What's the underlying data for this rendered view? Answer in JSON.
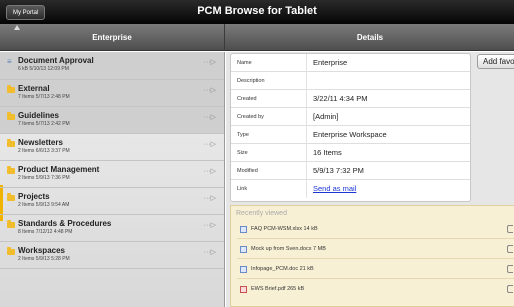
{
  "topbar": {
    "portal_button": "My Portal",
    "title": "PCM Browse for Tablet"
  },
  "headers": {
    "left": "Enterprise",
    "right": "Details"
  },
  "folders": [
    {
      "icon": "document-icon",
      "title": "Document Approval",
      "meta": "6 kB 5/10/13 12:09 PM",
      "selected": true
    },
    {
      "icon": "folder-icon",
      "title": "External",
      "meta": "7 Items 5/7/13 2:48 PM",
      "selected": true
    },
    {
      "icon": "folder-icon",
      "title": "Guidelines",
      "meta": "7 Items 5/7/13 2:42 PM",
      "selected": true
    },
    {
      "icon": "folder-icon",
      "title": "Newsletters",
      "meta": "2 Items 6/6/13 3:37 PM",
      "selected": false
    },
    {
      "icon": "folder-icon",
      "title": "Product Management",
      "meta": "2 Items 5/9/13 7:36 PM",
      "selected": false
    },
    {
      "icon": "folder-icon",
      "title": "Projects",
      "meta": "2 Items 5/9/13 9:54 AM",
      "selected": false
    },
    {
      "icon": "folder-icon",
      "title": "Standards & Procedures",
      "meta": "8 Items 7/12/12 4:48 PM",
      "selected": false
    },
    {
      "icon": "folder-icon",
      "title": "Workspaces",
      "meta": "2 Items 5/9/13 5:28 PM",
      "selected": false
    }
  ],
  "details": [
    {
      "label": "Name",
      "value": "Enterprise"
    },
    {
      "label": "Description",
      "value": ""
    },
    {
      "label": "Created",
      "value": "3/22/11 4:34 PM"
    },
    {
      "label": "Created by",
      "value": "[Admin]"
    },
    {
      "label": "Type",
      "value": "Enterprise Workspace"
    },
    {
      "label": "Size",
      "value": "16 Items"
    },
    {
      "label": "Modified",
      "value": "5/9/13 7:32 PM"
    },
    {
      "label": "Link",
      "value": "Send as mail"
    }
  ],
  "add_favorite_label": "Add favorite",
  "recently_viewed": {
    "title": "Recently viewed",
    "items": [
      {
        "icon": "spreadsheet-icon",
        "text": "FAQ PCM-WSM.xlsx 14 kB"
      },
      {
        "icon": "word-doc-icon",
        "text": "Mock up from Sven.docx 7 MB"
      },
      {
        "icon": "word-doc-icon",
        "text": "Infopage_PCM.doc 21 kB"
      },
      {
        "icon": "pdf-icon",
        "text": "EWS Brief.pdf 265 kB"
      }
    ]
  },
  "colors": {
    "accent": "#f0b400",
    "folder": "#f1bd2c",
    "link": "#1c36d6",
    "recent_bg": "#f8f0d4"
  }
}
